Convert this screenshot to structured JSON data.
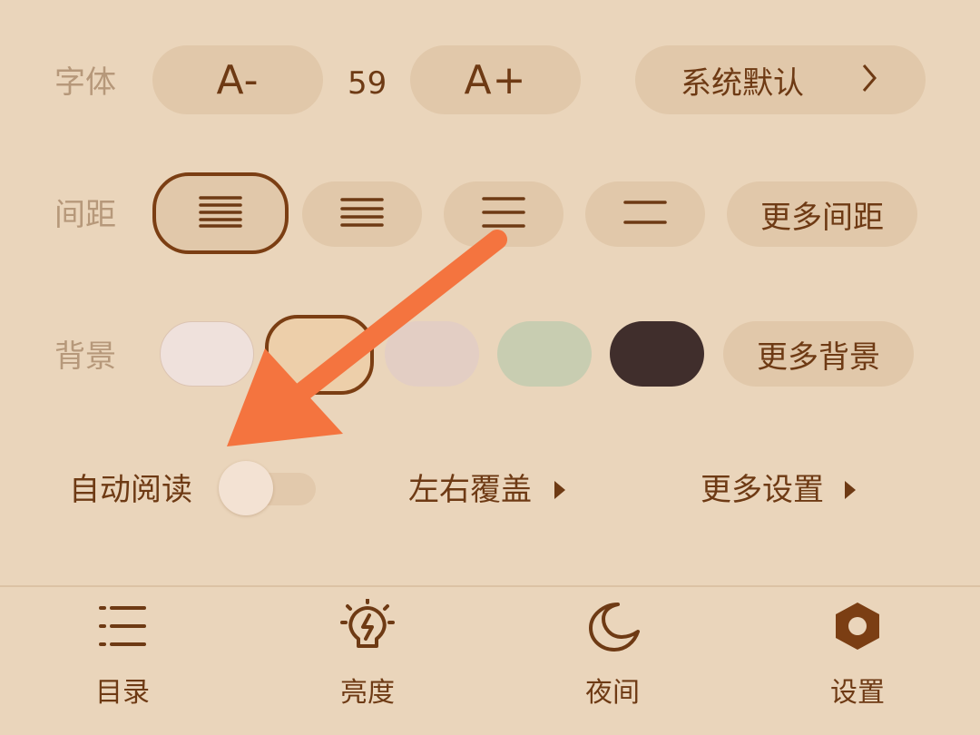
{
  "font": {
    "label": "字体",
    "decrease_label": "A-",
    "size_value": "59",
    "increase_label": "A+",
    "family_label": "系统默认",
    "family_chevron": ">"
  },
  "spacing": {
    "label": "间距",
    "options": [
      "compact-lines-icon",
      "normal-lines-icon",
      "wide-lines-icon",
      "widest-lines-icon"
    ],
    "selected_index": 0,
    "more_label": "更多间距"
  },
  "background": {
    "label": "背景",
    "colors": [
      "#efe1dc",
      "#edcfaa",
      "#e3cec4",
      "#c8cdb1",
      "#402e2c"
    ],
    "selected_index": 1,
    "more_label": "更多背景"
  },
  "options": {
    "auto_read_label": "自动阅读",
    "auto_read_on": false,
    "page_turn_label": "左右覆盖",
    "more_settings_label": "更多设置"
  },
  "tabs": [
    {
      "label": "目录",
      "icon": "list-icon"
    },
    {
      "label": "亮度",
      "icon": "lightbulb-icon"
    },
    {
      "label": "夜间",
      "icon": "moon-icon"
    },
    {
      "label": "设置",
      "icon": "gear-icon"
    }
  ],
  "colors": {
    "background": "#ead5bb",
    "button": "#e1c8aa",
    "accent": "#7b3e13",
    "annotation_arrow": "#f4743f"
  }
}
